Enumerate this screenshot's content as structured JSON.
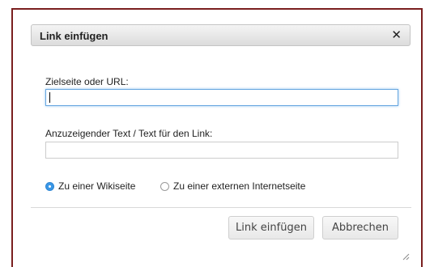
{
  "dialog": {
    "title": "Link einfügen",
    "close_glyph": "✕"
  },
  "target": {
    "label": "Zielseite oder URL:",
    "value": ""
  },
  "display_text": {
    "label": "Anzuzeigender Text / Text für den Link:",
    "value": ""
  },
  "link_type": {
    "options": [
      {
        "label": "Zu einer Wikiseite",
        "selected": true
      },
      {
        "label": "Zu einer externen Internetseite",
        "selected": false
      }
    ]
  },
  "buttons": {
    "insert_label": "Link einfügen",
    "cancel_label": "Abbrechen"
  },
  "colors": {
    "dialog_border": "#7a1f1f",
    "radio_selected": "#3a97e6",
    "focus_border": "#68a7e0"
  },
  "icons": {
    "close": "close-icon",
    "resize": "resize-grip-icon"
  }
}
